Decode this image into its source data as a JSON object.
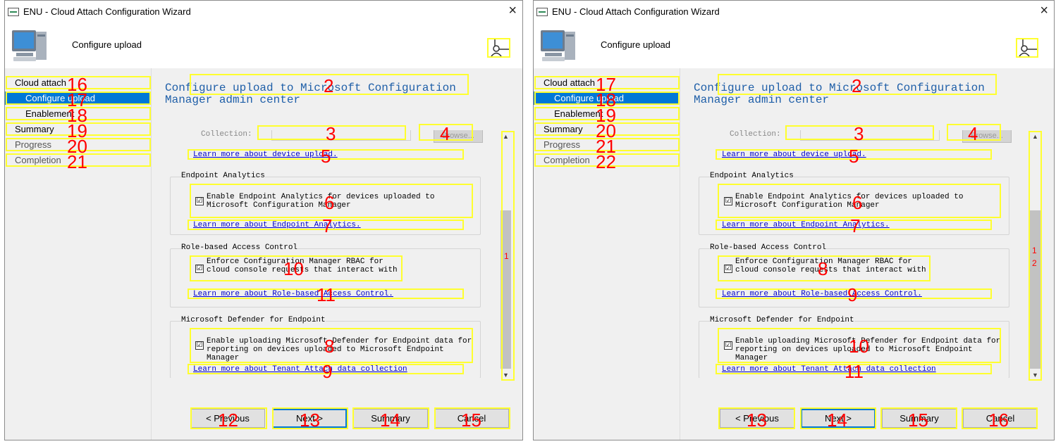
{
  "window_title": "ENU - Cloud Attach Configuration Wizard",
  "close_glyph": "×",
  "header_title": "Configure upload",
  "nav": {
    "cloud_attach": "Cloud attach",
    "configure_upload": "Configure upload",
    "enablement": "Enablement",
    "summary": "Summary",
    "progress": "Progress",
    "completion": "Completion"
  },
  "content": {
    "heading": "Configure upload to Microsoft Configuration Manager admin center",
    "collection_label": "Collection:",
    "browse_label": "Browse...",
    "device_upload_link": "Learn more about device upload.",
    "endpoint_analytics": {
      "group_label": "Endpoint Analytics",
      "checkbox_text": "Enable Endpoint Analytics for devices uploaded to Microsoft Configuration Manager",
      "checked": true,
      "link": "Learn more about Endpoint Analytics."
    },
    "rbac": {
      "group_label": "Role-based Access Control",
      "checkbox_text": "Enforce Configuration Manager RBAC for cloud console requests that interact with",
      "checked": true,
      "link": "Learn more about Role-based Access Control."
    },
    "defender": {
      "group_label": "Microsoft Defender for Endpoint",
      "checkbox_text": "Enable uploading Microsoft Defender for Endpoint data for reporting on devices uploaded to Microsoft Endpoint Manager",
      "checked": true,
      "link": "Learn more about Tenant Attach data collection"
    },
    "check_glyph": "☑",
    "scroll_up_glyph": "▲",
    "scroll_down_glyph": "▼"
  },
  "buttons": {
    "previous": "< Previous",
    "next": "Next >",
    "summary": "Summary",
    "cancel": "Cancel"
  },
  "annotations": {
    "left": {
      "heading": "2",
      "collection": "3",
      "browse": "4",
      "device_link": "5",
      "ea_checkbox": "6",
      "ea_link": "7",
      "defender_checkbox": "8",
      "defender_link": "9",
      "rbac_checkbox": "10",
      "rbac_link": "11",
      "previous": "12",
      "next": "13",
      "summary": "14",
      "cancel": "15",
      "nav_cloud_attach": "16",
      "nav_configure_upload": "17",
      "nav_enablement": "18",
      "nav_summary": "19",
      "nav_progress": "20",
      "nav_completion": "21",
      "scroll_label_1": "1"
    },
    "right": {
      "heading": "2",
      "collection": "3",
      "browse": "4",
      "device_link": "5",
      "ea_checkbox": "6",
      "ea_link": "7",
      "rbac_checkbox": "8",
      "rbac_link": "9",
      "defender_checkbox": "10",
      "defender_link": "11",
      "previous": "13",
      "next": "14",
      "summary": "15",
      "cancel": "16",
      "nav_cloud_attach": "17",
      "nav_configure_upload": "18",
      "nav_enablement": "19",
      "nav_summary": "20",
      "nav_progress": "21",
      "nav_completion": "22",
      "scroll_label_1": "1",
      "scroll_label_2": "2"
    }
  },
  "colors": {
    "selected_nav": "#0078d7",
    "heading": "#1f5fa8",
    "link": "#0000cc",
    "annotation_box": "#ffff2e",
    "annotation_number": "#ff0000"
  }
}
